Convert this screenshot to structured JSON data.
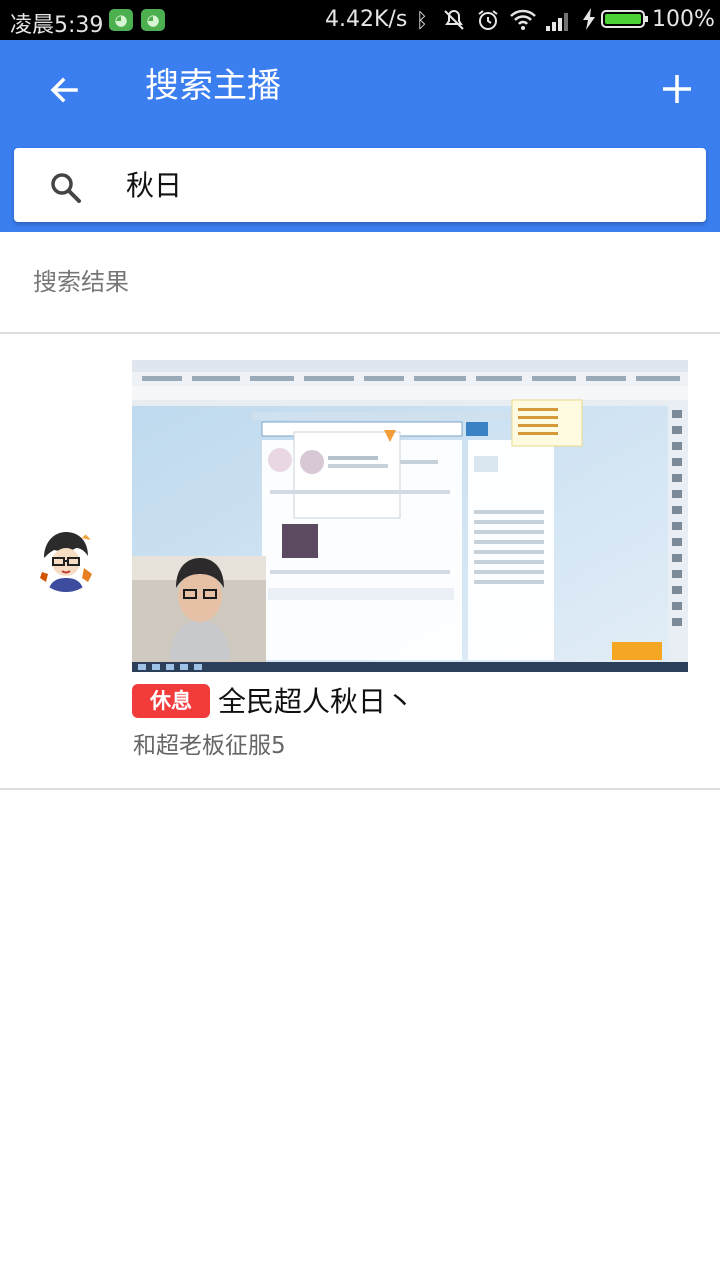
{
  "status_bar": {
    "time": "凌晨5:39",
    "notification_icons": [
      "app-notification-icon",
      "app-notification-icon"
    ],
    "net_speed": "4.42K/s",
    "icons": [
      "bluetooth-icon",
      "mute-icon",
      "alarm-icon",
      "wifi-icon",
      "signal-icon",
      "charging-icon"
    ],
    "battery_percent": "100%",
    "battery_level": 1.0
  },
  "app_bar": {
    "title": "搜索主播",
    "back_icon": "arrow-left-icon",
    "add_icon": "plus-icon",
    "background_color": "#3b7ef0"
  },
  "search": {
    "value": "秋日",
    "icon": "search-icon"
  },
  "results": {
    "header": "搜索结果",
    "items": [
      {
        "status": "休息",
        "status_color": "#f23b3b",
        "name": "全民超人秋日丶",
        "title": "和超老板征服5"
      }
    ]
  }
}
